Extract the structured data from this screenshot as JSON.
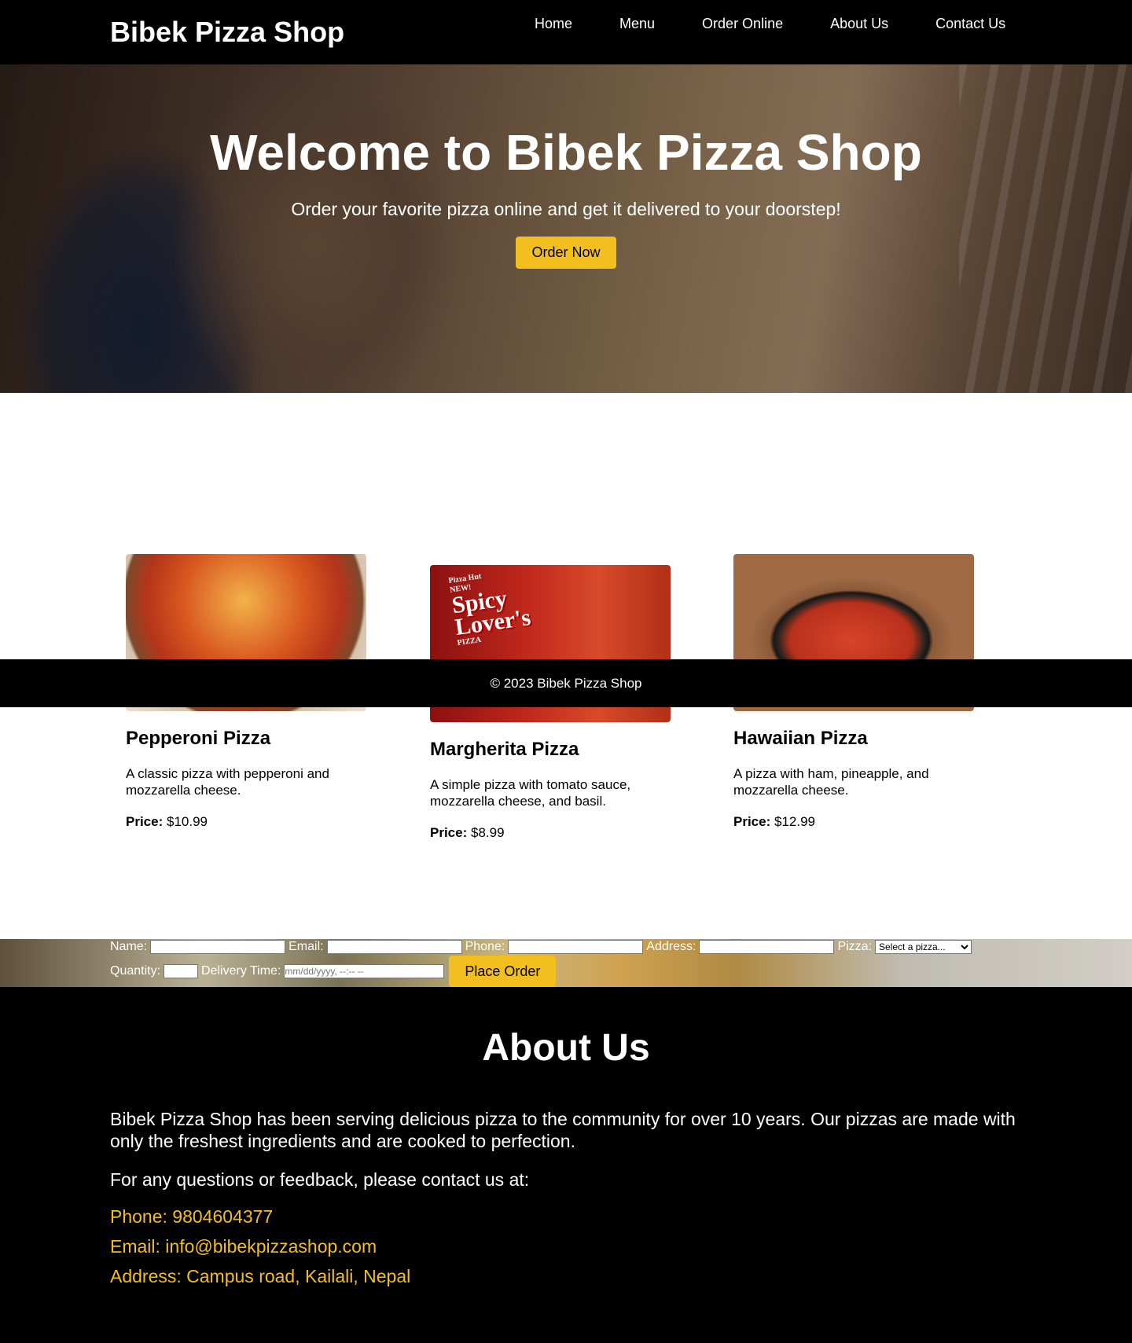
{
  "header": {
    "brand": "Bibek Pizza Shop",
    "nav": [
      "Home",
      "Menu",
      "Order Online",
      "About Us",
      "Contact Us"
    ]
  },
  "hero": {
    "title": "Welcome to Bibek Pizza Shop",
    "subtitle": "Order your favorite pizza online and get it delivered to your doorstep!",
    "cta": "Order Now"
  },
  "menu": [
    {
      "name": "Pepperoni Pizza",
      "description": "A classic pizza with pepperoni and mozzarella cheese.",
      "price_label": "Price:",
      "price": "$10.99"
    },
    {
      "name": "Margherita Pizza",
      "description": "A simple pizza with tomato sauce, mozzarella cheese, and basil.",
      "price_label": "Price:",
      "price": "$8.99",
      "image_text": [
        "NEW!",
        "Pizza Hut",
        "Spicy",
        "Lover's",
        "PIZZA"
      ]
    },
    {
      "name": "Hawaiian Pizza",
      "description": "A pizza with ham, pineapple, and mozzarella cheese.",
      "price_label": "Price:",
      "price": "$12.99"
    }
  ],
  "footer": {
    "copyright": "© 2023 Bibek Pizza Shop"
  },
  "order_form": {
    "name_label": "Name:",
    "email_label": "Email:",
    "phone_label": "Phone:",
    "address_label": "Address:",
    "pizza_label": "Pizza:",
    "pizza_placeholder": "Select a pizza...",
    "quantity_label": "Quantity:",
    "delivery_label": "Delivery Time:",
    "delivery_placeholder": "mm/dd/yyyy, --:-- --",
    "submit": "Place Order"
  },
  "about": {
    "title": "About Us",
    "paragraph": "Bibek Pizza Shop has been serving delicious pizza to the community for over 10 years. Our pizzas are made with only the freshest ingredients and are cooked to perfection.",
    "contact_intro": "For any questions or feedback, please contact us at:",
    "phone": "Phone: 9804604377",
    "email": "Email: info@bibekpizzashop.com",
    "address": "Address: Campus road, Kailali, Nepal"
  },
  "colors": {
    "accent": "#f2bf1f",
    "header_bg": "#000000"
  }
}
